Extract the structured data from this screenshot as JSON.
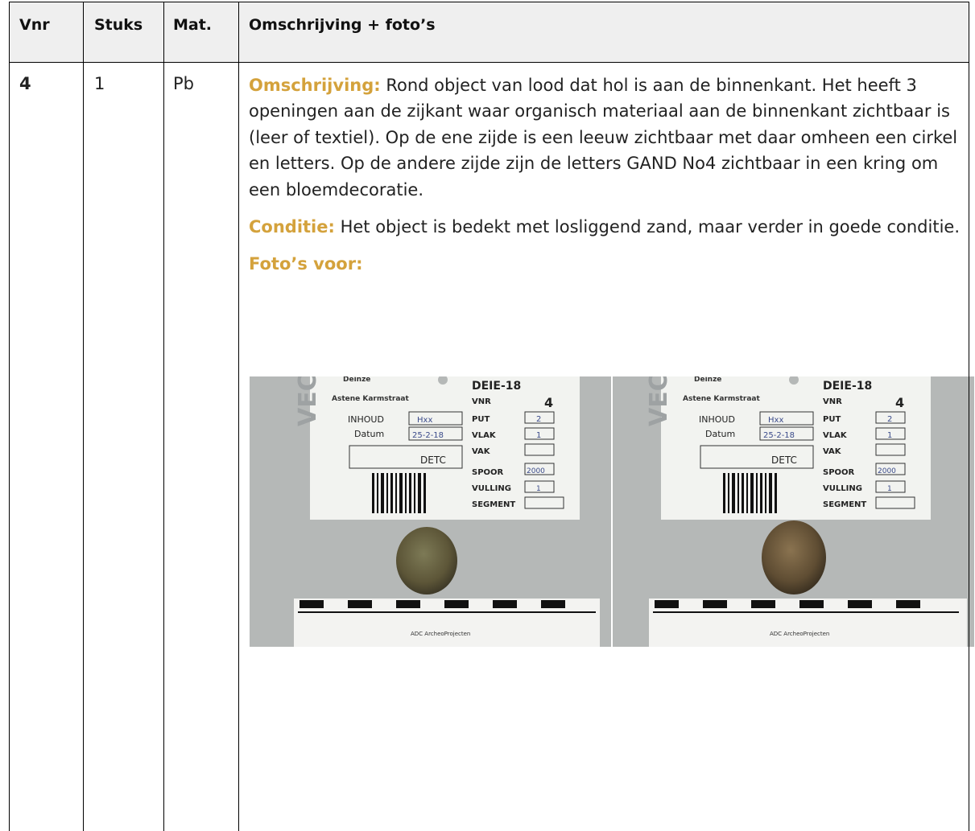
{
  "headers": {
    "vnr": "Vnr",
    "stuks": "Stuks",
    "mat": "Mat.",
    "omschrijving": "Omschrijving + foto’s"
  },
  "row": {
    "vnr": "4",
    "stuks": "1",
    "mat": "Pb",
    "omschrijving_label": "Omschrijving:",
    "omschrijving_text": " Rond object van lood dat hol is aan de binnenkant. Het heeft 3 openingen aan de zijkant waar organisch materiaal aan de binnenkant zichtbaar is (leer of textiel). Op de ene zijde is een leeuw zichtbaar met daar omheen een cirkel en letters. Op de andere zijde zijn de letters GAND No4 zichtbaar in een kring om een bloemdecoratie.",
    "conditie_label": "Conditie:",
    "conditie_text": " Het object is bedekt met losliggend zand, maar verder in goede conditie.",
    "fotos_label": "Foto’s voor:"
  },
  "photo_card": {
    "place": "Deinze",
    "street": "Astene Karmstraat",
    "code": "DEIE-18",
    "vnr_label": "VNR",
    "vnr_value": "4",
    "inhoud_label": "INHOUD",
    "inhoud_value": "Hxx",
    "datum_label": "Datum",
    "datum_value": "25-2-18",
    "put_label": "PUT",
    "put_value": "2",
    "vlak_label": "VLAK",
    "vlak_value": "1",
    "vak_label": "VAK",
    "spoor_label": "SPOOR",
    "spoor_value": "2000",
    "vulling_label": "VULLING",
    "vulling_value": "1",
    "segment_label": "SEGMENT",
    "note": "DETC",
    "logo": "VEC",
    "scale_text": "ADC ArcheoProjecten"
  },
  "colors": {
    "label_accent": "#d4a23c",
    "header_bg": "#efefef"
  }
}
